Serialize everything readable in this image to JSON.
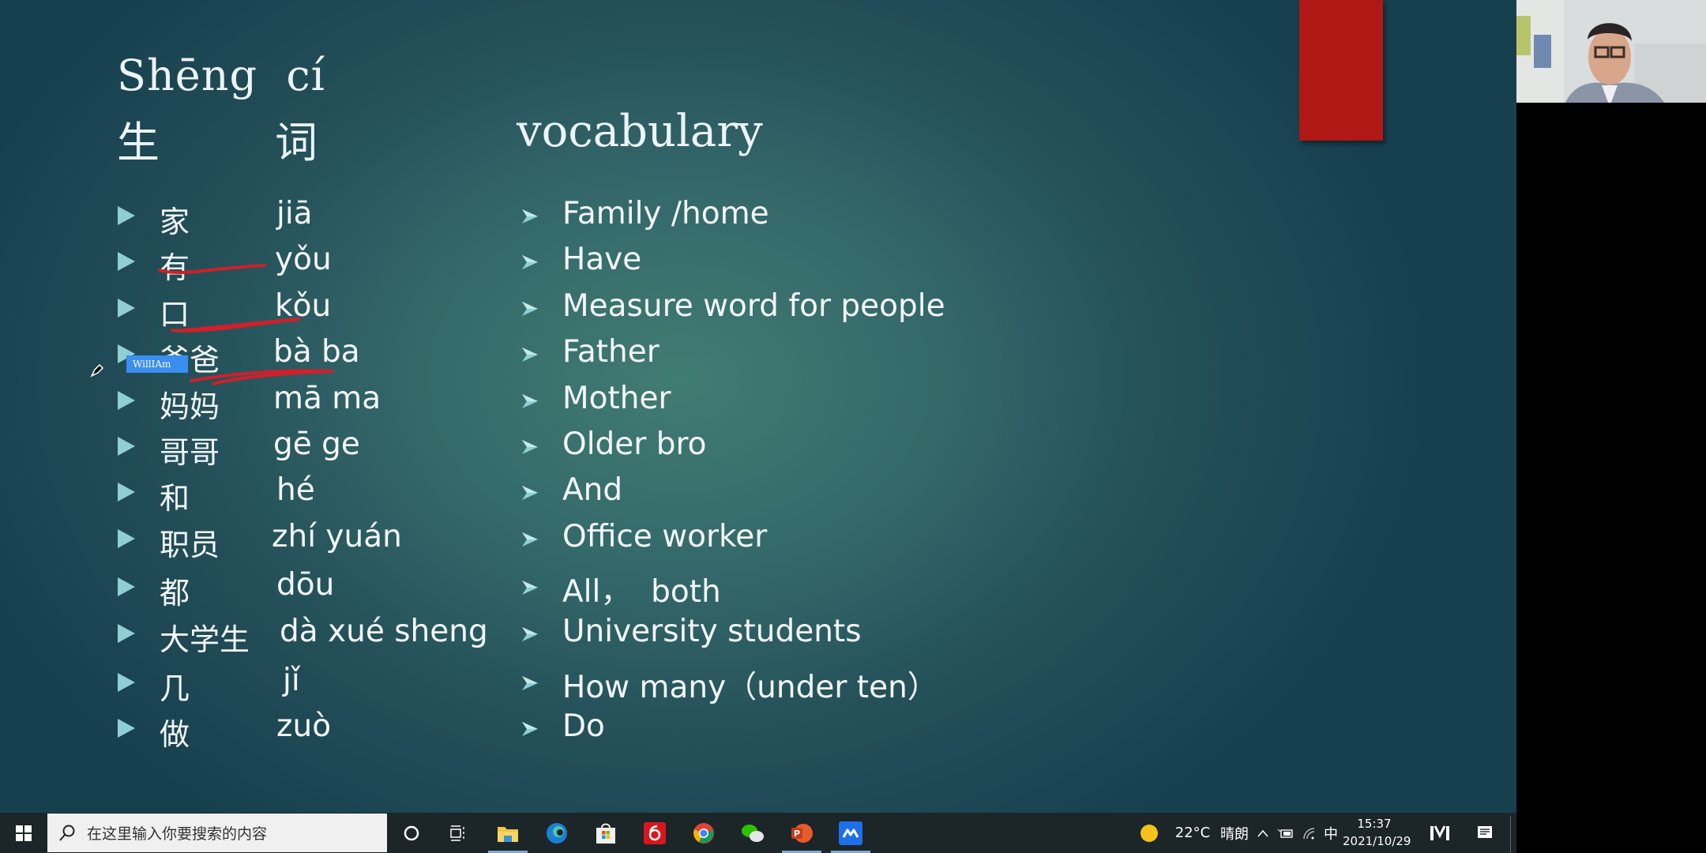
{
  "slide": {
    "title_pinyin": "Shēng  cí",
    "title_han_1": "生",
    "title_han_2": "词",
    "title_english": "vocabulary",
    "colors": {
      "background_center": "#417c72",
      "background_edge": "#17404f",
      "bullet": "#8fcfd3",
      "text": "#f3f7f8",
      "red_block": "#b01816",
      "ink": "#d0202a"
    },
    "rows": [
      {
        "han": "家",
        "pinyin": "jiā",
        "english": "Family /home"
      },
      {
        "han": "有",
        "pinyin": "yǒu",
        "english": "Have"
      },
      {
        "han": "口",
        "pinyin": "kǒu",
        "english": "Measure word for people"
      },
      {
        "han": "爸爸",
        "pinyin": "bà ba",
        "english": "Father"
      },
      {
        "han": "妈妈",
        "pinyin": "mā ma",
        "english": "Mother"
      },
      {
        "han": "哥哥",
        "pinyin": "gē ge",
        "english": "Older bro"
      },
      {
        "han": "和",
        "pinyin": "hé",
        "english": "And"
      },
      {
        "han": "职员",
        "pinyin": "zhí yuán",
        "english": "Office worker"
      },
      {
        "han": "都",
        "pinyin": "dōu",
        "english": "All，  both"
      },
      {
        "han": "大学生",
        "pinyin": "dà xué sheng",
        "english": "University students"
      },
      {
        "han": "几",
        "pinyin": "jǐ",
        "english": "How many（under ten）"
      },
      {
        "han": "做",
        "pinyin": "zuò",
        "english": "Do"
      }
    ],
    "annotator_name_tag": "WillIAm"
  },
  "taskbar": {
    "start_icon": "windows-logo-icon",
    "search_placeholder": "在这里输入你要搜索的内容",
    "pinned_apps": [
      {
        "name": "cortana",
        "icon": "circle-icon"
      },
      {
        "name": "task-view",
        "icon": "task-view-icon"
      },
      {
        "name": "file-explorer",
        "icon": "folder-icon",
        "active": true
      },
      {
        "name": "edge",
        "icon": "edge-icon"
      },
      {
        "name": "microsoft-store",
        "icon": "store-bag-icon"
      },
      {
        "name": "netease-music",
        "icon": "netease-music-icon"
      },
      {
        "name": "chrome",
        "icon": "chrome-icon"
      },
      {
        "name": "wechat",
        "icon": "wechat-icon"
      },
      {
        "name": "powerpoint",
        "icon": "powerpoint-icon",
        "active": true
      },
      {
        "name": "tencent-meeting",
        "icon": "meeting-icon",
        "active": true
      }
    ],
    "weather_temp": "22°C",
    "weather_desc": "晴朗",
    "ime": "中",
    "time": "15:37",
    "date": "2021/10/29"
  }
}
